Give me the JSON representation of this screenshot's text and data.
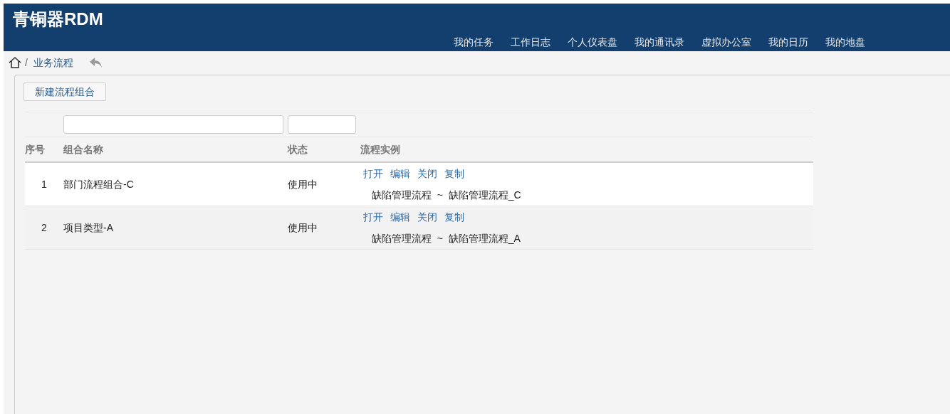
{
  "header": {
    "logo": "青铜器RDM",
    "nav": [
      "我的任务",
      "工作日志",
      "个人仪表盘",
      "我的通讯录",
      "虚拟办公室",
      "我的日历",
      "我的地盘"
    ]
  },
  "breadcrumb": {
    "separator": "/",
    "current": "业务流程"
  },
  "toolbar": {
    "new_button": "新建流程组合"
  },
  "table": {
    "columns": [
      "序号",
      "组合名称",
      "状态",
      "流程实例"
    ],
    "rows": [
      {
        "index": "1",
        "name": "部门流程组合-C",
        "status": "使用中",
        "actions": [
          "打开",
          "编辑",
          "关闭",
          "复制"
        ],
        "instance": "缺陷管理流程  ~  缺陷管理流程_C"
      },
      {
        "index": "2",
        "name": "项目类型-A",
        "status": "使用中",
        "actions": [
          "打开",
          "编辑",
          "关闭",
          "复制"
        ],
        "instance": "缺陷管理流程  ~  缺陷管理流程_A"
      }
    ]
  }
}
